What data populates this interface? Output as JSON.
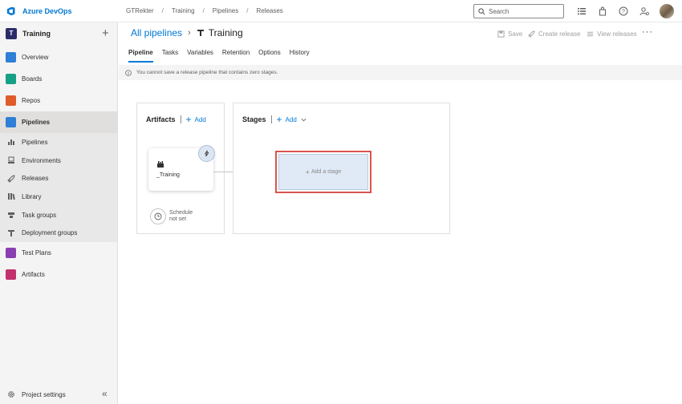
{
  "app": {
    "name": "Azure DevOps"
  },
  "breadcrumb": [
    "GTRekter",
    "Training",
    "Pipelines",
    "Releases"
  ],
  "search": {
    "placeholder": "Search"
  },
  "project": {
    "initial": "T",
    "name": "Training"
  },
  "nav": {
    "items": [
      {
        "label": "Overview",
        "color": "#2f7fd6"
      },
      {
        "label": "Boards",
        "color": "#16a085"
      },
      {
        "label": "Repos",
        "color": "#e05c2a"
      },
      {
        "label": "Pipelines",
        "color": "#2f7fd6"
      }
    ],
    "sub_items": [
      "Pipelines",
      "Environments",
      "Releases",
      "Library",
      "Task groups",
      "Deployment groups"
    ],
    "items_after": [
      {
        "label": "Test Plans",
        "color": "#8a3fb0"
      },
      {
        "label": "Artifacts",
        "color": "#c2316b"
      }
    ],
    "settings_label": "Project settings"
  },
  "page": {
    "parent_link": "All pipelines",
    "title": "Training",
    "actions": {
      "save": "Save",
      "create_release": "Create release",
      "view_releases": "View releases"
    },
    "tabs": [
      "Pipeline",
      "Tasks",
      "Variables",
      "Retention",
      "Options",
      "History"
    ],
    "active_tab": "Pipeline",
    "info_message": "You cannot save a release pipeline that contains zero stages."
  },
  "artifacts_panel": {
    "title": "Artifacts",
    "add_label": "Add",
    "artifact_name": "_Training",
    "schedule_line1": "Schedule",
    "schedule_line2": "not set"
  },
  "stages_panel": {
    "title": "Stages",
    "add_label": "Add",
    "add_stage_label": "Add a stage"
  },
  "colors": {
    "accent": "#0078d4",
    "highlight_border": "#d9534f"
  }
}
